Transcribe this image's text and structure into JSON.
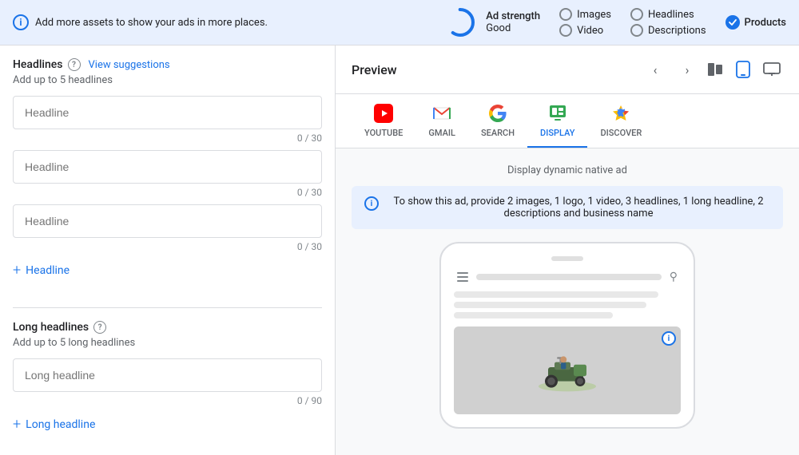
{
  "topBar": {
    "infoText": "Add more assets to show your ads in more places.",
    "adStrength": {
      "label": "Ad strength",
      "value": "Good"
    },
    "radioOptions": [
      {
        "id": "images",
        "label": "Images",
        "checked": false
      },
      {
        "id": "video",
        "label": "Video",
        "checked": false
      },
      {
        "id": "headlines",
        "label": "Headlines",
        "checked": false
      },
      {
        "id": "descriptions",
        "label": "Descriptions",
        "checked": false
      }
    ],
    "products": {
      "label": "Products",
      "checked": true
    }
  },
  "leftPanel": {
    "headlines": {
      "title": "Headlines",
      "subtitle": "Add up to 5 headlines",
      "viewSuggestions": "View suggestions",
      "inputs": [
        {
          "placeholder": "Headline",
          "charCount": "0 / 30"
        },
        {
          "placeholder": "Headline",
          "charCount": "0 / 30"
        },
        {
          "placeholder": "Headline",
          "charCount": "0 / 30"
        }
      ],
      "addLabel": "Headline"
    },
    "longHeadlines": {
      "title": "Long headlines",
      "subtitle": "Add up to 5 long headlines",
      "inputs": [
        {
          "placeholder": "Long headline",
          "charCount": "0 / 90"
        }
      ],
      "addLabel": "Long headline"
    }
  },
  "rightPanel": {
    "preview": {
      "title": "Preview"
    },
    "platforms": [
      {
        "id": "youtube",
        "label": "YOUTUBE",
        "active": false
      },
      {
        "id": "gmail",
        "label": "GMAIL",
        "active": false
      },
      {
        "id": "search",
        "label": "SEARCH",
        "active": false
      },
      {
        "id": "display",
        "label": "DISPLAY",
        "active": true
      },
      {
        "id": "discover",
        "label": "DISCOVER",
        "active": false
      }
    ],
    "adTypeLabel": "Display dynamic native ad",
    "infoBanner": "To show this ad, provide 2 images, 1 logo, 1 video, 3 headlines, 1 long headline, 2 descriptions and business name"
  }
}
